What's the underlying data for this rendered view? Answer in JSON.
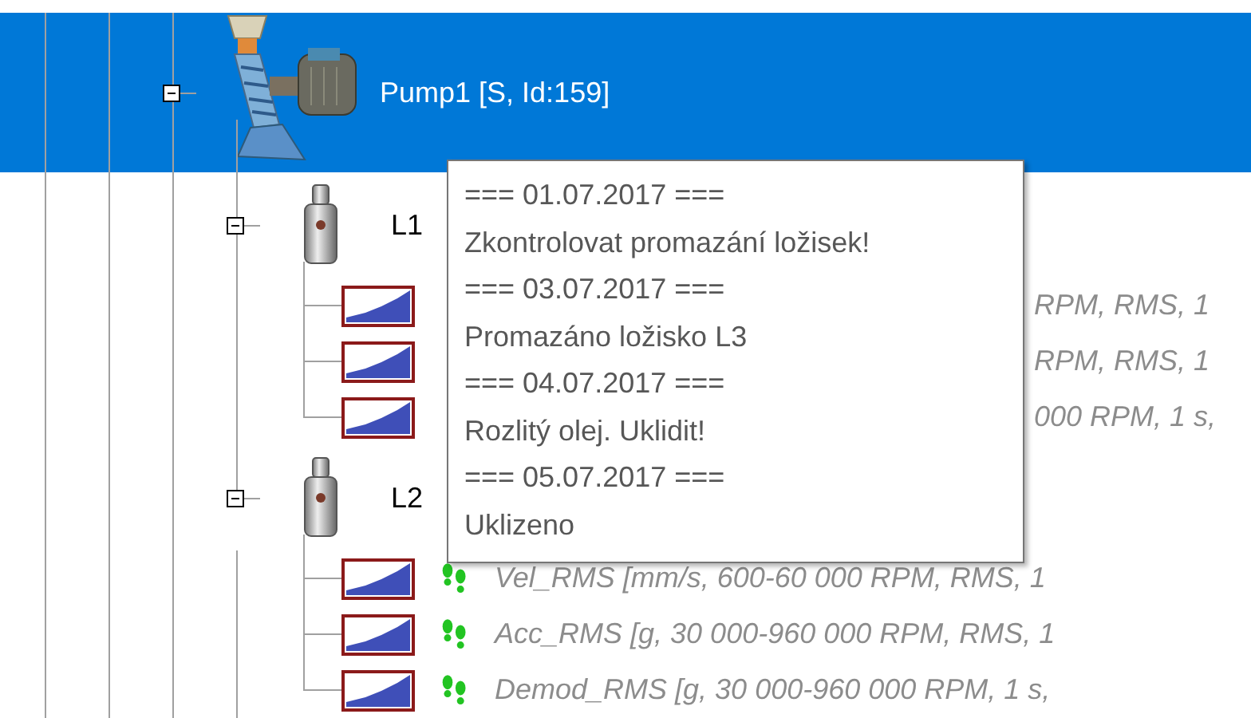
{
  "tree": {
    "label": "Pump1 [S, Id:159]",
    "selected": true,
    "expanded": true,
    "children": [
      {
        "label": "L1",
        "expanded": true,
        "children": [
          {
            "label": "RPM, RMS, 1",
            "kind": "covered"
          },
          {
            "label": "RPM, RMS, 1",
            "kind": "covered"
          },
          {
            "label": "000 RPM, 1 s,",
            "kind": "covered"
          }
        ]
      },
      {
        "label": "L2",
        "expanded": true,
        "children": [
          {
            "label": "Vel_RMS [mm/s, 600-60 000 RPM, RMS, 1",
            "kind": "full"
          },
          {
            "label": "Acc_RMS [g, 30 000-960 000 RPM, RMS, 1",
            "kind": "full"
          },
          {
            "label": "Demod_RMS [g, 30 000-960 000 RPM, 1 s,",
            "kind": "full"
          }
        ]
      }
    ]
  },
  "tooltip": {
    "lines": [
      "=== 01.07.2017 ===",
      "Zkontrolovat promazání ložisek!",
      "=== 03.07.2017 ===",
      "Promazáno ložisko L3",
      "=== 04.07.2017 ===",
      "Rozlitý olej. Uklidit!",
      "=== 05.07.2017 ===",
      "Uklizeno"
    ]
  }
}
